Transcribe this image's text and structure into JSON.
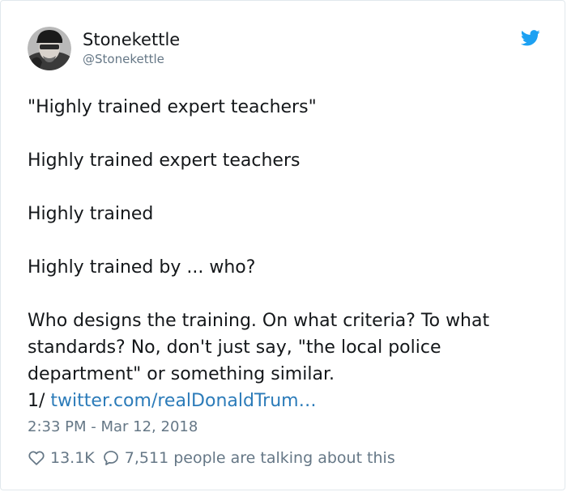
{
  "author": {
    "display_name": "Stonekettle",
    "handle": "@Stonekettle"
  },
  "tweet": {
    "lines": [
      "\"Highly trained expert teachers\"",
      "Highly trained expert teachers",
      "Highly trained",
      "Highly trained by ... who?",
      "Who designs the training. On what criteria? To what",
      "standards? No, don't just say, \"the local police",
      "department\" or something similar."
    ],
    "thread_prefix": "1/",
    "link_text": "twitter.com/realDonaldTrum…"
  },
  "timestamp": "2:33 PM - Mar 12, 2018",
  "stats": {
    "likes": "13.1K",
    "talking": "7,511 people are talking about this"
  },
  "icons": {
    "brand": "twitter-bird-icon",
    "like": "heart-icon",
    "reply": "speech-bubble-icon"
  },
  "colors": {
    "brand_blue": "#1da1f2",
    "link_blue": "#2b7bb9",
    "secondary_text": "#657786",
    "primary_text": "#14171a",
    "border": "#e1e8ed"
  }
}
